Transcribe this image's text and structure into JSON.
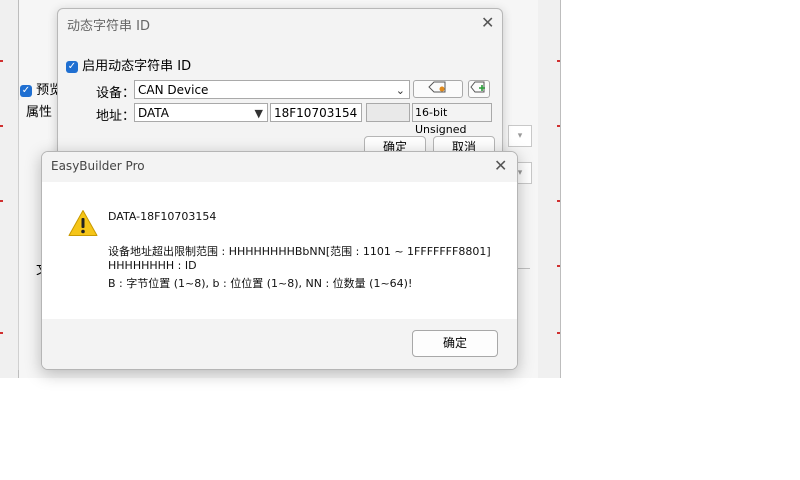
{
  "background_app": {
    "preview_label": "预览",
    "attributes_label": "属性",
    "partial_label": "文"
  },
  "string_id_dialog": {
    "title": "动态字符串 ID",
    "close_glyph": "✕",
    "enable_label": "启用动态字符串 ID",
    "device_label": "设备：",
    "device_value": "CAN Device",
    "address_label": "地址：",
    "address_type": "DATA",
    "address_value": "18F10703154",
    "data_type": "16-bit Unsigned",
    "ok_label": "确定",
    "cancel_label": "取消"
  },
  "error_dialog": {
    "title": "EasyBuilder Pro",
    "close_glyph": "✕",
    "icon": "warning-icon",
    "line1": "DATA-18F10703154",
    "line2": "设备地址超出限制范围 : HHHHHHHHBbNN[范围 : 1101 ~ 1FFFFFFF8801]",
    "line3": "HHHHHHHH : ID",
    "line4": "B : 字节位置 (1~8), b : 位位置 (1~8), NN : 位数量 (1~64)!",
    "ok_label": "确定"
  },
  "colors": {
    "accent": "#1f6fd1",
    "warning": "#f5c518"
  }
}
